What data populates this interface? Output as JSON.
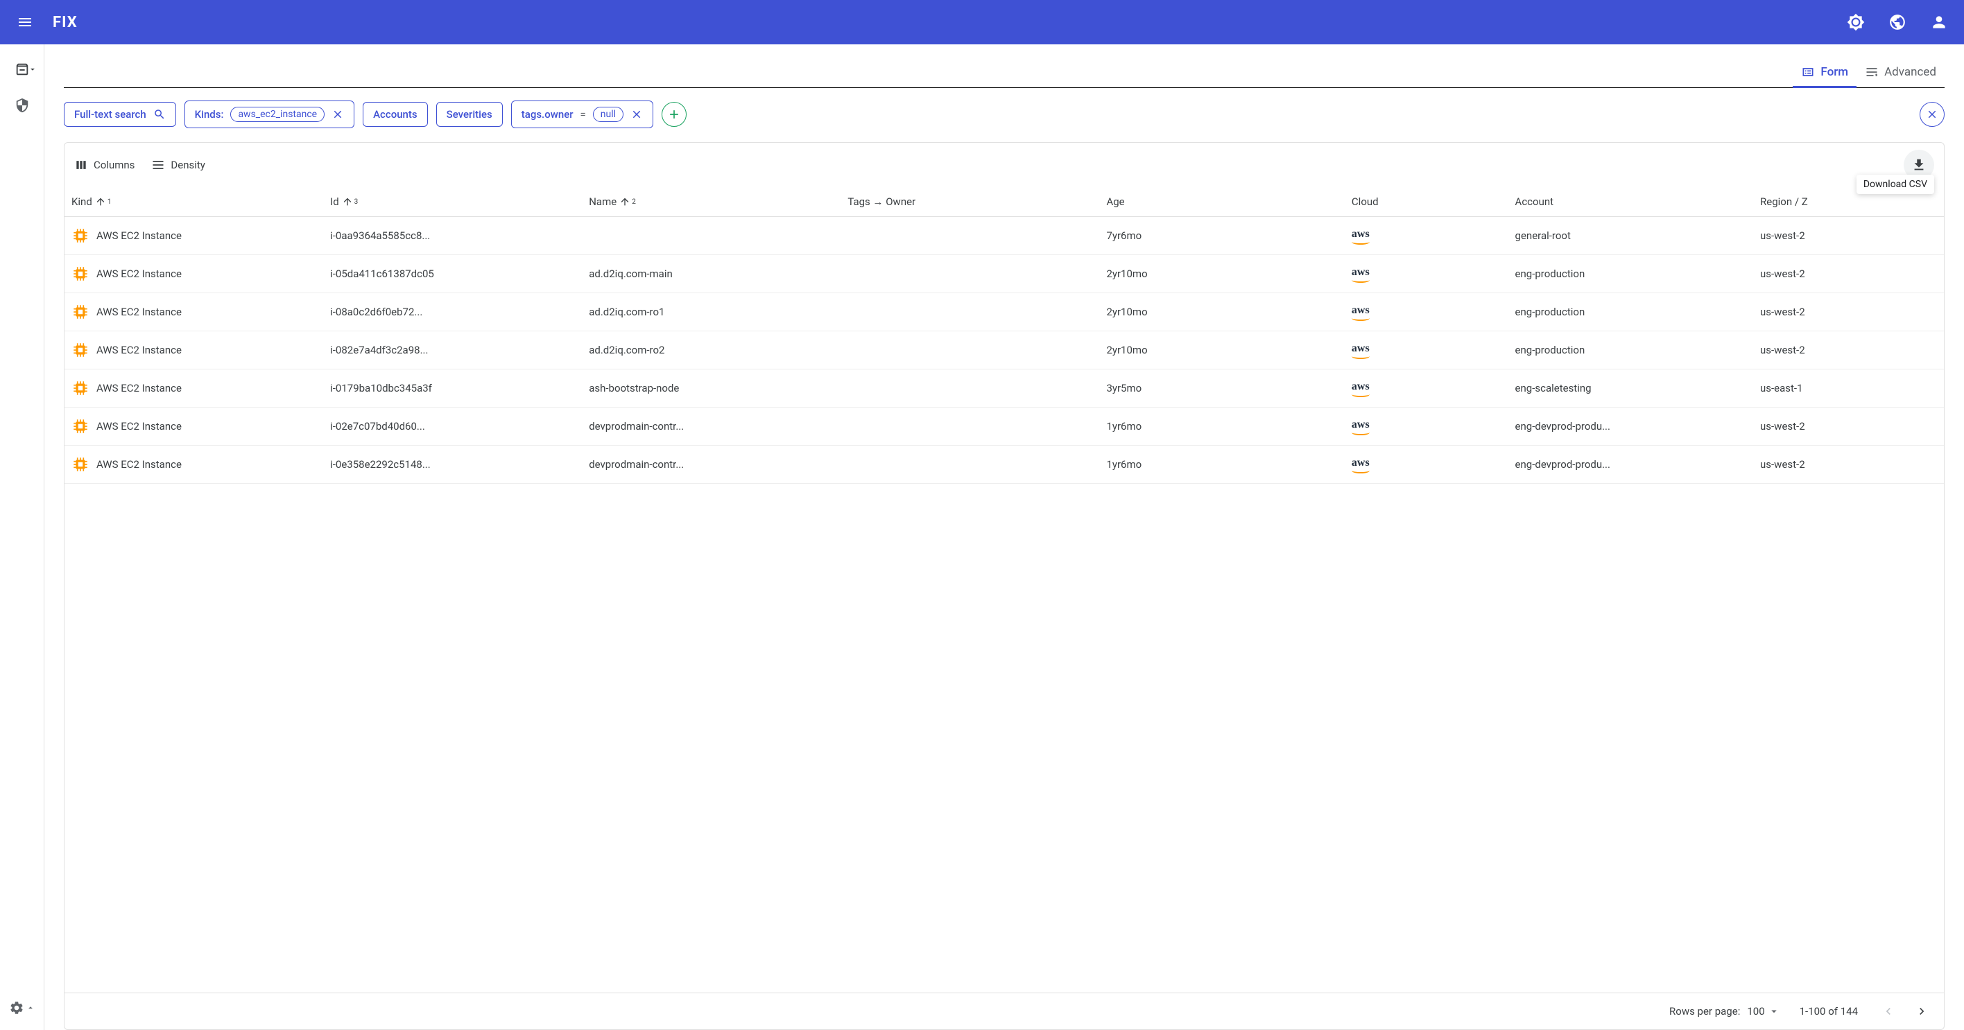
{
  "header": {
    "logo": "FIX"
  },
  "tabs": {
    "form": "Form",
    "advanced": "Advanced"
  },
  "filters": {
    "fulltext": "Full-text search",
    "kinds_label": "Kinds:",
    "kinds_value": "aws_ec2_instance",
    "accounts": "Accounts",
    "severities": "Severities",
    "tag_key": "tags.owner",
    "tag_op": "=",
    "tag_val": "null"
  },
  "toolbar": {
    "columns": "Columns",
    "density": "Density",
    "download_tooltip": "Download CSV"
  },
  "columns": {
    "kind": "Kind",
    "id": "Id",
    "name": "Name",
    "tags": "Tags",
    "owner": "Owner",
    "age": "Age",
    "cloud": "Cloud",
    "account": "Account",
    "region": "Region / Z"
  },
  "sort_indices": {
    "kind": "1",
    "id": "3",
    "name": "2"
  },
  "rows": [
    {
      "kind": "AWS EC2 Instance",
      "id": "i-0aa9364a5585cc8...",
      "name": "",
      "owner": "",
      "age": "7yr6mo",
      "cloud": "aws",
      "account": "general-root",
      "region": "us-west-2"
    },
    {
      "kind": "AWS EC2 Instance",
      "id": "i-05da411c61387dc05",
      "name": "ad.d2iq.com-main",
      "owner": "",
      "age": "2yr10mo",
      "cloud": "aws",
      "account": "eng-production",
      "region": "us-west-2"
    },
    {
      "kind": "AWS EC2 Instance",
      "id": "i-08a0c2d6f0eb72...",
      "name": "ad.d2iq.com-ro1",
      "owner": "",
      "age": "2yr10mo",
      "cloud": "aws",
      "account": "eng-production",
      "region": "us-west-2"
    },
    {
      "kind": "AWS EC2 Instance",
      "id": "i-082e7a4df3c2a98...",
      "name": "ad.d2iq.com-ro2",
      "owner": "",
      "age": "2yr10mo",
      "cloud": "aws",
      "account": "eng-production",
      "region": "us-west-2"
    },
    {
      "kind": "AWS EC2 Instance",
      "id": "i-0179ba10dbc345a3f",
      "name": "ash-bootstrap-node",
      "owner": "",
      "age": "3yr5mo",
      "cloud": "aws",
      "account": "eng-scaletesting",
      "region": "us-east-1"
    },
    {
      "kind": "AWS EC2 Instance",
      "id": "i-02e7c07bd40d60...",
      "name": "devprodmain-contr...",
      "owner": "",
      "age": "1yr6mo",
      "cloud": "aws",
      "account": "eng-devprod-produ...",
      "region": "us-west-2"
    },
    {
      "kind": "AWS EC2 Instance",
      "id": "i-0e358e2292c5148...",
      "name": "devprodmain-contr...",
      "owner": "",
      "age": "1yr6mo",
      "cloud": "aws",
      "account": "eng-devprod-produ...",
      "region": "us-west-2"
    }
  ],
  "pagination": {
    "rows_label": "Rows per page:",
    "rows_value": "100",
    "range": "1-100 of 144"
  }
}
